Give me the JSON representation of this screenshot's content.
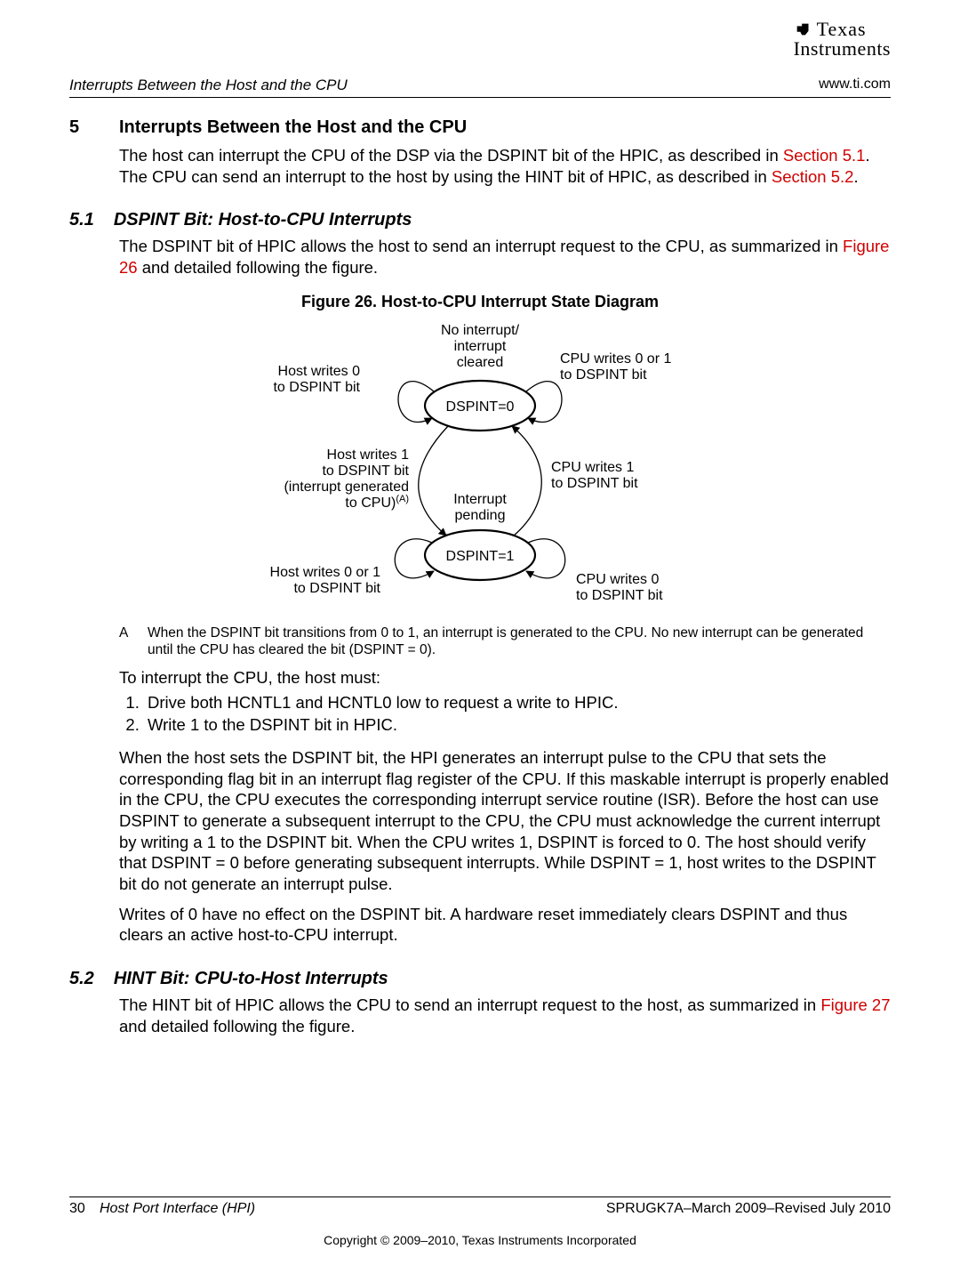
{
  "header": {
    "running_left": "Interrupts Between the Host and the CPU",
    "running_right": "www.ti.com",
    "logo_line1": "Texas",
    "logo_line2": "Instruments"
  },
  "section5": {
    "num": "5",
    "title": "Interrupts Between the Host and the CPU",
    "intro_a": "The host can interrupt the CPU of the DSP via the DSPINT bit of the HPIC, as described in ",
    "intro_ref1": "Section 5.1",
    "intro_b": ". The CPU can send an interrupt to the host by using the HINT bit of HPIC, as described in ",
    "intro_ref2": "Section 5.2",
    "intro_c": "."
  },
  "section5_1": {
    "num": "5.1",
    "title": "DSPINT Bit: Host-to-CPU Interrupts",
    "p1a": "The DSPINT bit of HPIC allows the host to send an interrupt request to the CPU, as summarized in ",
    "p1ref": "Figure 26",
    "p1b": " and detailed following the figure.",
    "fig_caption": "Figure 26. Host-to-CPU Interrupt State Diagram",
    "diagram": {
      "top_label_l1": "No interrupt/",
      "top_label_l2": "interrupt",
      "top_label_l3": "cleared",
      "state0": "DSPINT=0",
      "state1": "DSPINT=1",
      "middle_l1": "Interrupt",
      "middle_l2": "pending",
      "left_top_l1": "Host writes 0",
      "left_top_l2": "to DSPINT bit",
      "right_top_l1": "CPU writes 0 or 1",
      "right_top_l2": "to DSPINT bit",
      "left_mid_l1": "Host writes 1",
      "left_mid_l2": "to DSPINT bit",
      "left_mid_l3": "(interrupt generated",
      "left_mid_l4": "to CPU)",
      "left_mid_sup": "(A)",
      "right_mid_l1": "CPU writes 1",
      "right_mid_l2": "to DSPINT bit",
      "left_bot_l1": "Host writes 0 or 1",
      "left_bot_l2": "to DSPINT bit",
      "right_bot_l1": "CPU writes 0",
      "right_bot_l2": "to DSPINT bit"
    },
    "footnote_mark": "A",
    "footnote": "When the DSPINT bit transitions from 0 to 1, an interrupt is generated to the CPU. No new interrupt can be generated until the CPU has cleared the bit (DSPINT = 0).",
    "p2": "To interrupt the CPU, the host must:",
    "steps": [
      "Drive both HCNTL1 and HCNTL0 low to request a write to HPIC.",
      "Write 1 to the DSPINT bit in HPIC."
    ],
    "p3": "When the host sets the DSPINT bit, the HPI generates an interrupt pulse to the CPU that sets the corresponding flag bit in an interrupt flag register of the CPU. If this maskable interrupt is properly enabled in the CPU, the CPU executes the corresponding interrupt service routine (ISR). Before the host can use DSPINT to generate a subsequent interrupt to the CPU, the CPU must acknowledge the current interrupt by writing a 1 to the DSPINT bit. When the CPU writes 1, DSPINT is forced to 0. The host should verify that DSPINT = 0 before generating subsequent interrupts. While DSPINT = 1, host writes to the DSPINT bit do not generate an interrupt pulse.",
    "p4": "Writes of 0 have no effect on the DSPINT bit. A hardware reset immediately clears DSPINT and thus clears an active host-to-CPU interrupt."
  },
  "section5_2": {
    "num": "5.2",
    "title": "HINT Bit: CPU-to-Host Interrupts",
    "p1a": "The HINT bit of HPIC allows the CPU to send an interrupt request to the host, as summarized in ",
    "p1ref": "Figure 27",
    "p1b": " and detailed following the figure."
  },
  "footer": {
    "page": "30",
    "doc": "Host Port Interface (HPI)",
    "rev": "SPRUGK7A–March 2009–Revised July 2010",
    "copyright": "Copyright © 2009–2010, Texas Instruments Incorporated"
  }
}
